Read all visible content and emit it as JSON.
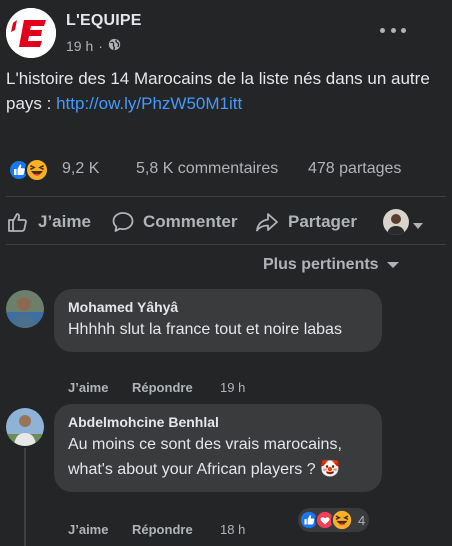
{
  "post": {
    "page_name": "L'EQUIPE",
    "time": "19 h",
    "dot": "·",
    "text": "L'histoire des 14 Marocains de la liste nés dans un autre pays : ",
    "link": "http://ow.ly/PhzW50M1itt"
  },
  "stats": {
    "reactions_count": "9,2 K",
    "comments": "5,8 K commentaires",
    "shares": "478 partages"
  },
  "actions": {
    "like": "J’aime",
    "comment": "Commenter",
    "share": "Partager"
  },
  "sort_label": "Plus pertinents",
  "comments": [
    {
      "author": "Mohamed Yâhyâ",
      "text": "Hhhhh slut la france tout et noire labas",
      "like": "J’aime",
      "reply": "Répondre",
      "time": "19 h"
    },
    {
      "author": "Abdelmohcine Benhlal",
      "text": "Au moins ce sont des vrais marocains, what's about your African players ?",
      "emoji": "🤡",
      "like": "J’aime",
      "reply": "Répondre",
      "time": "18 h",
      "reaction_count": "4"
    }
  ],
  "colors": {
    "background": "#242526",
    "bubble": "#3a3b3c",
    "link": "#4599ff",
    "like_blue": "#1877f2",
    "love_red": "#f33e58",
    "haha_yellow": "#f7b125",
    "logo_red": "#e2001a"
  },
  "icons": {
    "public": "globe-icon",
    "more": "more-options-icon",
    "like": "thumb-up-icon",
    "comment": "speech-bubble-icon",
    "share": "share-arrow-icon",
    "caret": "caret-down-icon"
  }
}
